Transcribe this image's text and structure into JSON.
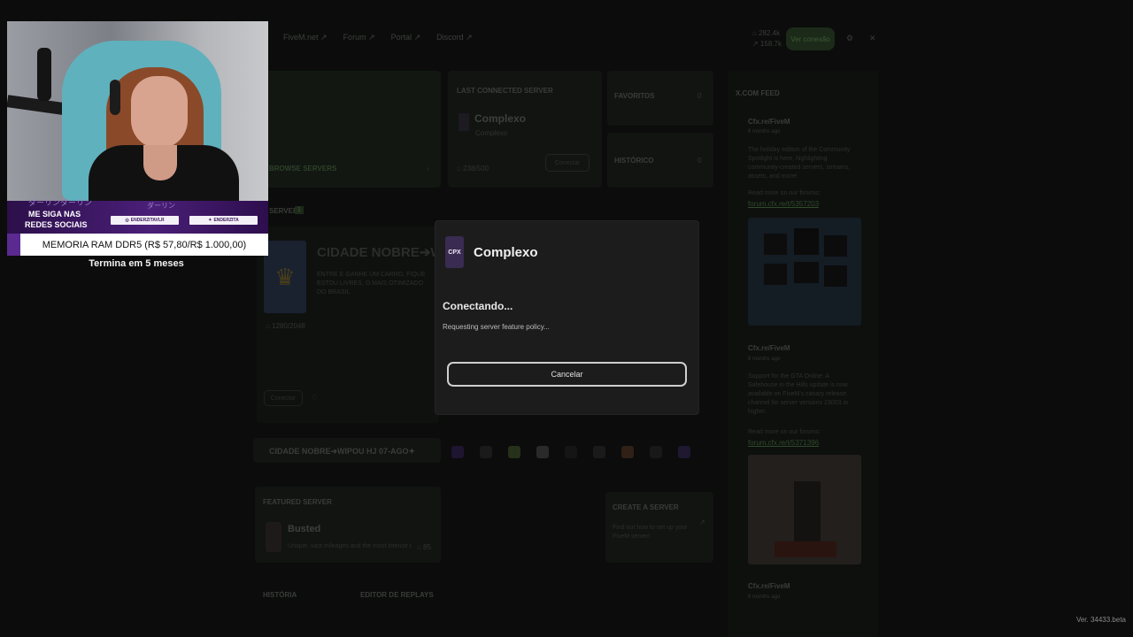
{
  "nav": {
    "items": [
      "FiveM.net ↗",
      "Forum ↗",
      "Portal ↗",
      "Discord ↗"
    ],
    "stats_line1": "⌂ 282.4k",
    "stats_line2": "↗ 158.7k",
    "connect_label": "Ver conexão"
  },
  "last_connected": {
    "header": "LAST CONNECTED SERVER",
    "name": "Complexo",
    "subtitle": "Complexo",
    "players": "⌂ 238/500",
    "button": "Conectar"
  },
  "browse": {
    "label": "BROWSE SERVERS"
  },
  "favorites": {
    "label": "FAVORITOS",
    "count": "0"
  },
  "history": {
    "label": "HISTÓRICO",
    "count": "0"
  },
  "servers_section": {
    "label": "SERVERS",
    "count": "1"
  },
  "promoted": {
    "title": "CIDADE NOBRE➔WIPOU",
    "desc": "ENTRE E GANHE UM CARRO, FIQUE ESTOU LIVRES, O MAIS OTIMIZADO DO BRASIL",
    "players": "⌂ 1280/2048",
    "button": "Conectar"
  },
  "server_strip": {
    "name": "CIDADE NOBRE➔WIPOU HJ 07-AGO✦"
  },
  "featured": {
    "label": "FEATURED SERVER",
    "name": "Busted",
    "desc": "Unique, vast mileages and the most intense crazy...",
    "players": "⌂ 85"
  },
  "create_server": {
    "label": "CREATE A SERVER",
    "desc": "Find out how to set up your FiveM server!"
  },
  "bottom_tabs": {
    "history": "HISTÓRIA",
    "replays": "EDITOR DE REPLAYS"
  },
  "feed": {
    "header": "X.COM FEED",
    "posts": [
      {
        "author": "Cfx.re/FiveM",
        "time": "8 months ago",
        "text": "The holiday edition of the Community Spotlight is here, highlighting community-created servers, streams, assets, and more!",
        "link_label": "Read more on our forums:",
        "link": "forum.cfx.re/t/5357203"
      },
      {
        "author": "Cfx.re/FiveM",
        "time": "8 months ago",
        "text": "Support for the GTA Online: A Safehouse in the Hills update is now available on FiveM's canary release channel for server versions 23003 or higher.",
        "link_label": "Read more on our forums:",
        "link": "forum.cfx.re/t/5371396"
      },
      {
        "author": "Cfx.re/FiveM",
        "time": "8 months ago"
      }
    ]
  },
  "modal": {
    "server_name": "Complexo",
    "logo_text": "CPX",
    "status": "Conectando...",
    "substatus": "Requesting server feature policy...",
    "cancel": "Cancelar"
  },
  "overlay": {
    "social_title_line1": "ME SIGA NAS",
    "social_title_line2": "REDES SOCIAIS",
    "jp_deco1": "ダーリンダーリン",
    "jp_deco2": "ダーリン",
    "social_1": "ENDERZITAVLR",
    "social_2": "ENDERZITA",
    "promo": "MEMORIA RAM DDR5 (R$ 57,80/R$ 1.000,00)",
    "promo_sub": "Termina em 5 meses"
  },
  "version": "Ver. 34433.beta",
  "colors": {
    "accent_green": "#3b5a33",
    "overlay_purple": "#5b2a91",
    "modal_bg": "#1c1c1c"
  }
}
